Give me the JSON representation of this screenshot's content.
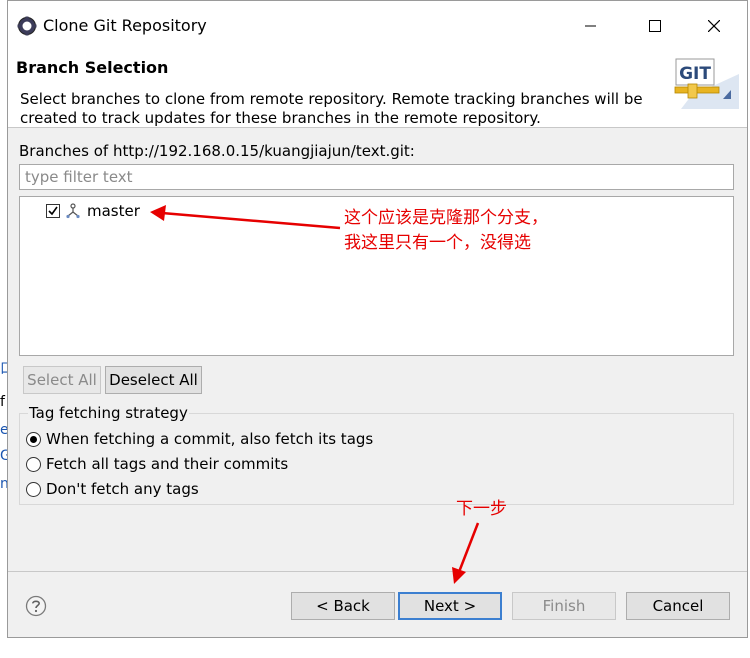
{
  "window": {
    "title": "Clone Git Repository"
  },
  "header": {
    "title": "Branch Selection",
    "description": "Select branches to clone from remote repository. Remote tracking branches will be created to track updates for these branches in the remote repository.",
    "logo_text": "GIT"
  },
  "branches": {
    "label": "Branches of http://192.168.0.15/kuangjiajun/text.git:",
    "filter_placeholder": "type filter text",
    "items": [
      {
        "label": "master",
        "checked": true
      }
    ]
  },
  "selection_buttons": {
    "select_all": "Select All",
    "deselect_all": "Deselect All"
  },
  "tag_strategy": {
    "title": "Tag fetching strategy",
    "options": [
      {
        "label": "When fetching a commit, also fetch its tags",
        "selected": true
      },
      {
        "label": "Fetch all tags and their commits",
        "selected": false
      },
      {
        "label": "Don't fetch any tags",
        "selected": false
      }
    ]
  },
  "footer": {
    "back": "< Back",
    "next": "Next >",
    "finish": "Finish",
    "cancel": "Cancel"
  },
  "annotations": {
    "branch_note_line1": "这个应该是克隆那个分支，",
    "branch_note_line2": "我这里只有一个，没得选",
    "next_note": "下一步"
  },
  "background_fragments": [
    "口",
    "f",
    "ex",
    "G",
    "n"
  ],
  "colors": {
    "annotation": "#e60000",
    "default_button_border": "#3c7fd0",
    "dialog_bg": "#f0f0f0"
  }
}
